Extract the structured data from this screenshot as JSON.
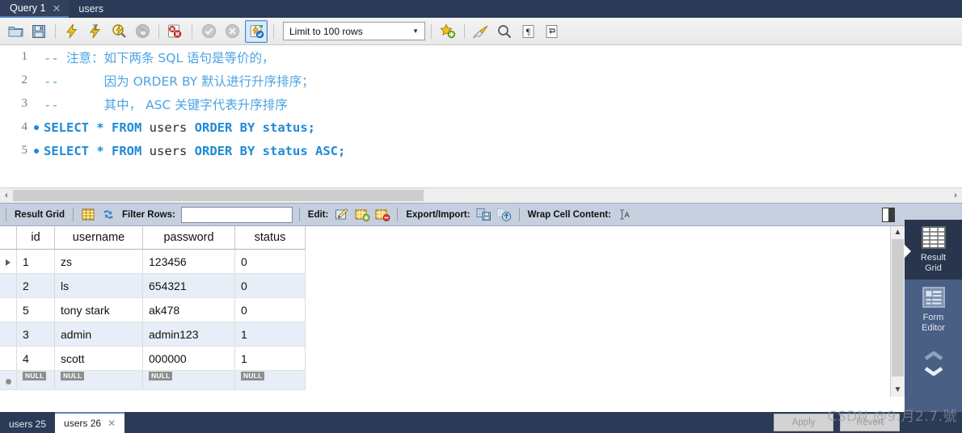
{
  "window": {
    "top_tabs": [
      {
        "label": "Query 1",
        "closable": true,
        "active": true
      },
      {
        "label": "users",
        "closable": false,
        "active": false
      }
    ]
  },
  "toolbar": {
    "icons": [
      {
        "name": "open-sql-script-icon",
        "title": "Open SQL Script"
      },
      {
        "name": "save-sql-script-icon",
        "title": "Save SQL Script"
      },
      {
        "name": "execute-statement-icon",
        "title": "Execute"
      },
      {
        "name": "execute-current-statement-icon",
        "title": "Execute Current Statement"
      },
      {
        "name": "explain-statement-icon",
        "title": "Explain Current Statement"
      },
      {
        "name": "stop-execution-icon",
        "title": "Stop"
      },
      {
        "name": "toggle-stop-on-error-icon",
        "title": "Toggle whether execution should stop on error"
      },
      {
        "name": "commit-icon",
        "title": "Commit"
      },
      {
        "name": "rollback-icon",
        "title": "Rollback"
      },
      {
        "name": "toggle-autocommit-icon",
        "title": "Toggle Autocommit"
      }
    ],
    "limit_select": {
      "value": "Limit to 100 rows"
    },
    "right_icons": [
      {
        "name": "new-snippet-icon",
        "title": "Save current statement to snippet"
      },
      {
        "name": "beautify-sql-icon",
        "title": "Beautify SQL"
      },
      {
        "name": "find-icon",
        "title": "Find"
      },
      {
        "name": "toggle-invisible-chars-icon",
        "title": "Toggle invisible characters"
      },
      {
        "name": "wrap-lines-icon",
        "title": "Toggle wrapping of long lines"
      }
    ]
  },
  "editor": {
    "lines": [
      {
        "number": "1",
        "has_dot": false,
        "tokens": [
          {
            "cls": "cmt",
            "text": "-- "
          },
          {
            "cls": "cmtcn",
            "text": "注意：如下两条 SQL 语句是等价的，"
          }
        ]
      },
      {
        "number": "2",
        "has_dot": false,
        "tokens": [
          {
            "cls": "cmt",
            "text": "--      "
          },
          {
            "cls": "cmtcn",
            "text": "因为 ORDER BY 默认进行升序排序；"
          }
        ]
      },
      {
        "number": "3",
        "has_dot": false,
        "tokens": [
          {
            "cls": "cmt",
            "text": "--      "
          },
          {
            "cls": "cmtcn",
            "text": "其中， ASC 关键字代表升序排序"
          }
        ]
      },
      {
        "number": "4",
        "has_dot": true,
        "tokens": [
          {
            "cls": "kw",
            "text": "SELECT "
          },
          {
            "cls": "punct",
            "text": "* "
          },
          {
            "cls": "kw",
            "text": "FROM "
          },
          {
            "cls": "ident",
            "text": "users "
          },
          {
            "cls": "kw",
            "text": "ORDER BY "
          },
          {
            "cls": "kw",
            "text": "status"
          },
          {
            "cls": "punct",
            "text": ";"
          }
        ]
      },
      {
        "number": "5",
        "has_dot": true,
        "tokens": [
          {
            "cls": "kw",
            "text": "SELECT "
          },
          {
            "cls": "punct",
            "text": "* "
          },
          {
            "cls": "kw",
            "text": "FROM "
          },
          {
            "cls": "ident",
            "text": "users "
          },
          {
            "cls": "kw",
            "text": "ORDER BY "
          },
          {
            "cls": "kw",
            "text": "status ASC"
          },
          {
            "cls": "punct",
            "text": ";"
          }
        ]
      }
    ],
    "hscroll": {
      "left_arrow": "‹",
      "right_arrow": "›"
    }
  },
  "result_toolbar": {
    "result_grid_label": "Result Grid",
    "filter_label": "Filter Rows:",
    "filter_value": "",
    "filter_placeholder": "",
    "edit_label": "Edit:",
    "export_label": "Export/Import:",
    "wrap_label": "Wrap Cell Content:",
    "wrap_glyph": "↑A"
  },
  "grid": {
    "columns": [
      "id",
      "username",
      "password",
      "status"
    ],
    "rows": [
      {
        "marker": "current",
        "cells": [
          "1",
          "zs",
          "123456",
          "0"
        ]
      },
      {
        "marker": "",
        "cells": [
          "2",
          "ls",
          "654321",
          "0"
        ]
      },
      {
        "marker": "",
        "cells": [
          "5",
          "tony stark",
          "ak478",
          "0"
        ]
      },
      {
        "marker": "",
        "cells": [
          "3",
          "admin",
          "admin123",
          "1"
        ]
      },
      {
        "marker": "",
        "cells": [
          "4",
          "scott",
          "000000",
          "1"
        ]
      }
    ],
    "null_row": {
      "marker": "new",
      "cells": [
        "NULL",
        "NULL",
        "NULL",
        "NULL"
      ]
    },
    "null_badge_text": "NULL"
  },
  "sidebar": {
    "items": [
      {
        "name": "result-grid",
        "line1": "Result",
        "line2": "Grid",
        "active": true
      },
      {
        "name": "form-editor",
        "line1": "Form",
        "line2": "Editor",
        "active": false
      }
    ],
    "chevron_up": "⌃",
    "chevron_down": "⌄"
  },
  "bottom": {
    "tabs": [
      {
        "label": "users 25",
        "active": false,
        "closable": false
      },
      {
        "label": "users 26",
        "active": true,
        "closable": true
      }
    ],
    "apply_label": "Apply",
    "revert_label": "Revert",
    "watermark": "CSDN @9.月2.7.號"
  },
  "colors": {
    "tabbar_bg": "#2b3a56",
    "toolbar_bg": "#efefef",
    "sidebar_bg": "#4a5f84",
    "sidebar_active_bg": "#28354d",
    "result_toolbar_bg": "#c6cfdd",
    "keyword": "#1f8ad6",
    "comment": "#4ba3e3",
    "alt_row": "#e8eef8",
    "accent_select": "#3c8ade"
  }
}
